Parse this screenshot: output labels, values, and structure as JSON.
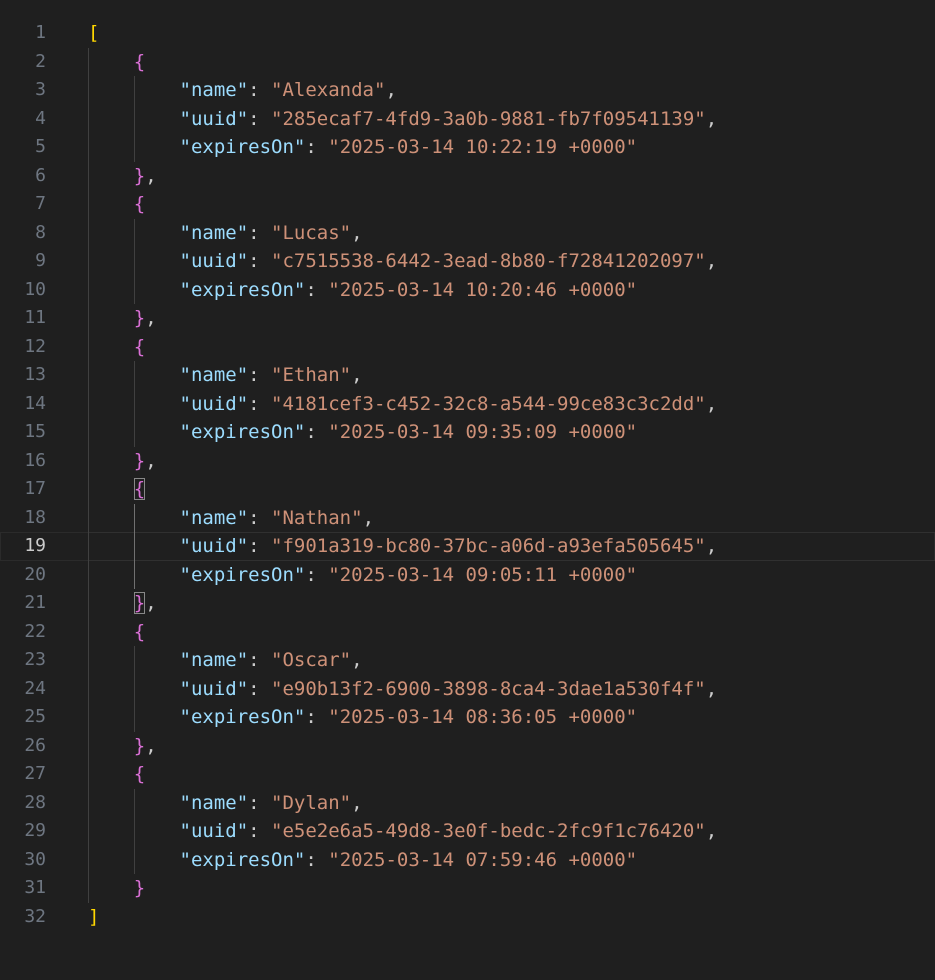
{
  "editor": {
    "open_bracket": "[",
    "close_bracket": "]",
    "current_line": 19,
    "records": [
      {
        "name": "Alexanda",
        "uuid": "285ecaf7-4fd9-3a0b-9881-fb7f09541139",
        "expiresOn": "2025-03-14 10:22:19 +0000"
      },
      {
        "name": "Lucas",
        "uuid": "c7515538-6442-3ead-8b80-f72841202097",
        "expiresOn": "2025-03-14 10:20:46 +0000"
      },
      {
        "name": "Ethan",
        "uuid": "4181cef3-c452-32c8-a544-99ce83c3c2dd",
        "expiresOn": "2025-03-14 09:35:09 +0000"
      },
      {
        "name": "Nathan",
        "uuid": "f901a319-bc80-37bc-a06d-a93efa505645",
        "expiresOn": "2025-03-14 09:05:11 +0000"
      },
      {
        "name": "Oscar",
        "uuid": "e90b13f2-6900-3898-8ca4-3dae1a530f4f",
        "expiresOn": "2025-03-14 08:36:05 +0000"
      },
      {
        "name": "Dylan",
        "uuid": "e5e2e6a5-49d8-3e0f-bedc-2fc9f1c76420",
        "expiresOn": "2025-03-14 07:59:46 +0000"
      }
    ],
    "keys": {
      "name": "\"name\"",
      "uuid": "\"uuid\"",
      "expiresOn": "\"expiresOn\""
    },
    "colors": {
      "background": "#1f1f1f",
      "line_number": "#6e7681",
      "key": "#9cdcfe",
      "string": "#ce9178",
      "bracket_level1": "#ffd700",
      "bracket_level2": "#da70d6"
    }
  }
}
